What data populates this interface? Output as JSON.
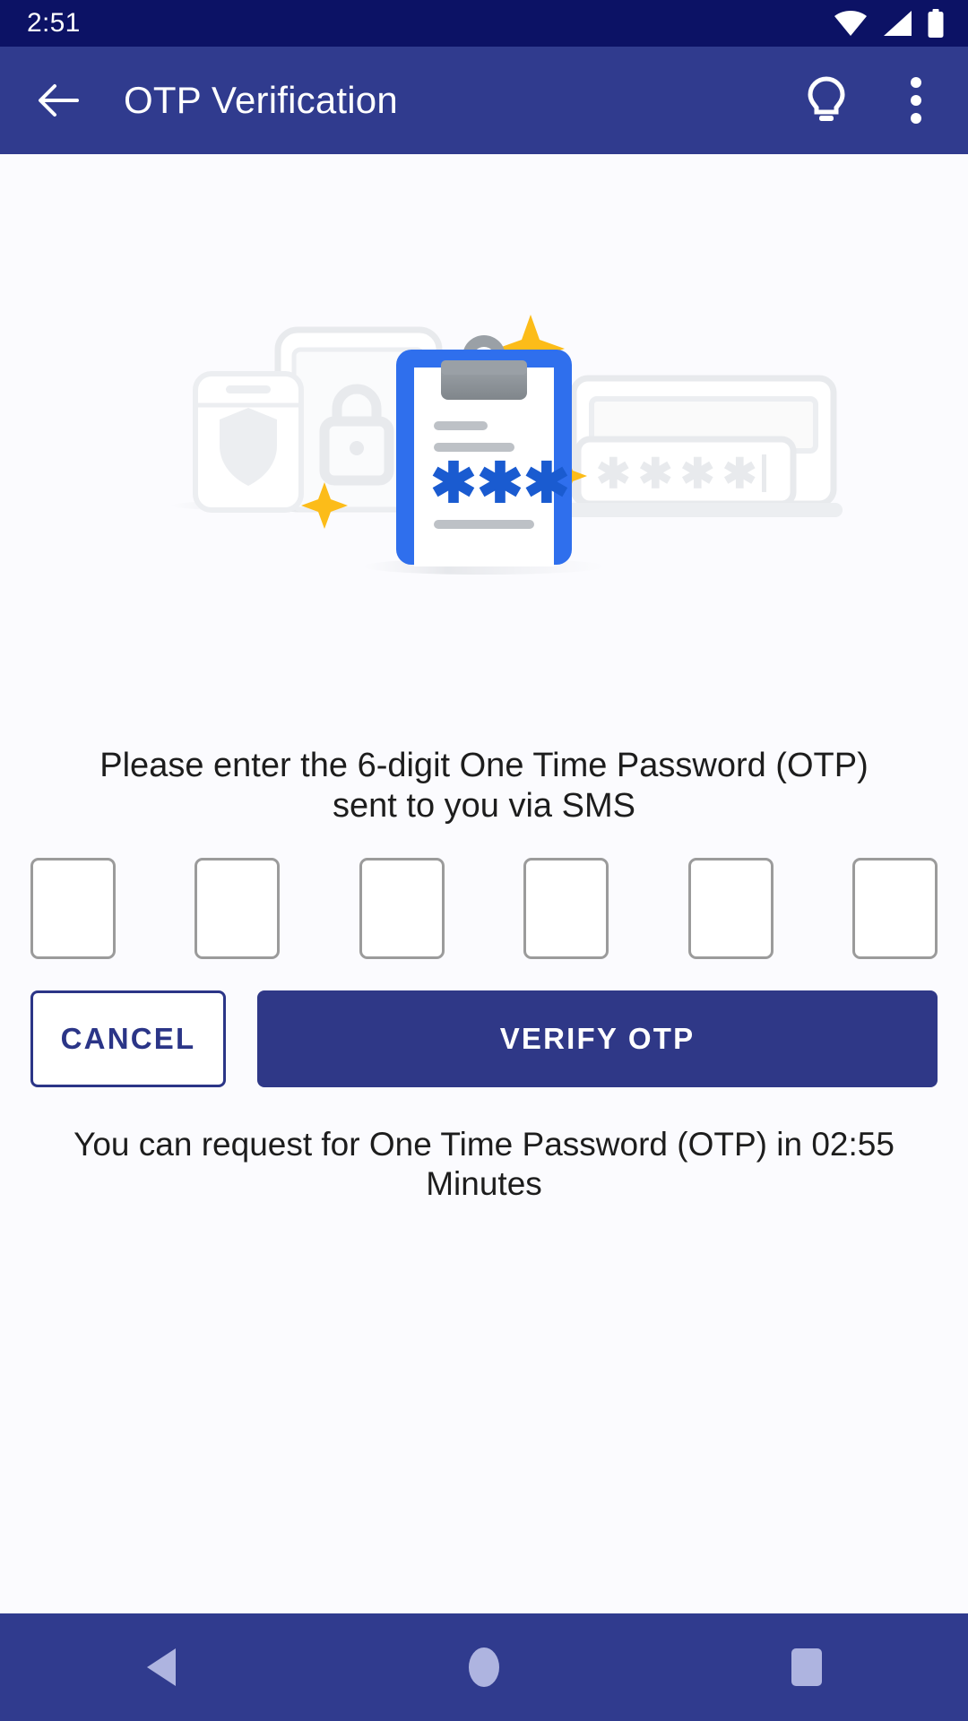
{
  "status_bar": {
    "time": "2:51",
    "icons": [
      "wifi-icon",
      "signal-icon",
      "battery-icon"
    ],
    "background": "#0c1265"
  },
  "app_bar": {
    "back_icon": "back-arrow-icon",
    "title": "OTP Verification",
    "actions": [
      {
        "icon": "lightbulb-icon",
        "name": "help-tip-button"
      },
      {
        "icon": "more-vert-icon",
        "name": "overflow-menu-button"
      }
    ],
    "background": "#303b8e"
  },
  "illustration": {
    "name": "otp-security-illustration",
    "elements": [
      "phone-with-shield",
      "tablet-with-lock",
      "laptop-with-password-field",
      "blue-clipboard-with-asterisks",
      "gold-sparkles"
    ],
    "clipboard_masked_text": "✱✱✱",
    "laptop_masked_text": "✱✱✱✱",
    "accent_blue": "#2f6fed",
    "sparkle_gold": "#fcbc19",
    "device_gray": "#e8eaed"
  },
  "main": {
    "instruction": "Please enter the 6-digit One Time Password (OTP) sent to you via SMS",
    "otp": {
      "label": "otp-input-group",
      "digits": [
        "",
        "",
        "",
        "",
        "",
        ""
      ],
      "count": 6,
      "border_color": "#9b9b9b"
    },
    "cancel_label": "CANCEL",
    "verify_label": "VERIFY OTP",
    "resend_text": "You can request for One Time Password (OTP) in 02:55 Minutes",
    "resend_timer": "02:55",
    "primary_color": "#2f3887"
  },
  "nav_bar": {
    "items": [
      {
        "name": "nav-back-button",
        "icon": "triangle-back-icon"
      },
      {
        "name": "nav-home-button",
        "icon": "circle-home-icon"
      },
      {
        "name": "nav-recents-button",
        "icon": "square-recents-icon"
      }
    ],
    "background": "#303b8e",
    "icon_color": "#aeb4e0"
  }
}
